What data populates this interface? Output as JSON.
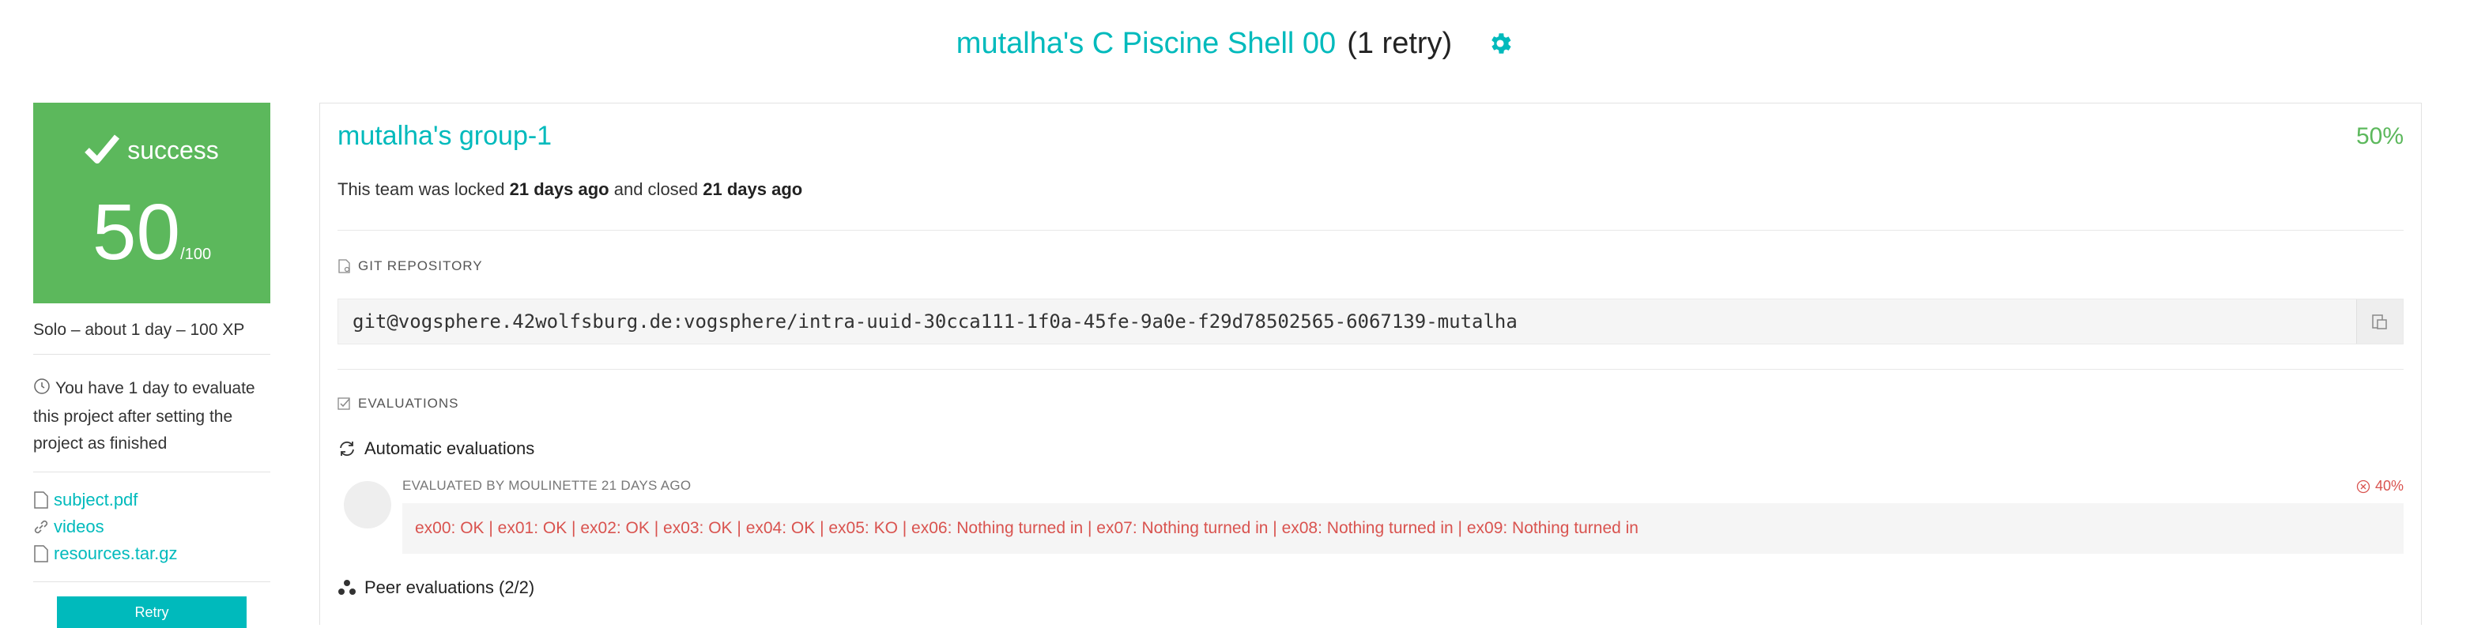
{
  "header": {
    "title": "mutalha's C Piscine Shell 00",
    "retry": "(1 retry)",
    "settings_icon": "gear-icon",
    "accent": "#00babc"
  },
  "status": {
    "label": "success",
    "score": "50",
    "max": "/100",
    "color": "#5cb85c",
    "icon": "check-icon"
  },
  "sidebar": {
    "meta": "Solo – about 1 day – 100 XP",
    "deadline": "You have 1 day to evaluate this project after setting the project as finished",
    "files": [
      {
        "label": "subject.pdf",
        "icon": "file-icon"
      },
      {
        "label": "videos",
        "icon": "link-icon"
      },
      {
        "label": "resources.tar.gz",
        "icon": "file-icon"
      }
    ],
    "retry_label": "Retry"
  },
  "team": {
    "name": "mutalha's group-1",
    "percent": "50%",
    "locked_prefix": "This team was locked",
    "locked_time": "21 days ago",
    "closed_word": "and closed",
    "closed_time": "21 days ago"
  },
  "repo": {
    "section": "GIT REPOSITORY",
    "url": "git@vogsphere.42wolfsburg.de:vogsphere/intra-uuid-30cca111-1f0a-45fe-9a0e-f29d78502565-6067139-mutalha"
  },
  "evaluations": {
    "section": "EVALUATIONS",
    "automatic": "Automatic evaluations",
    "evaluated_by": "EVALUATED BY MOULINETTE 21 DAYS AGO",
    "auto_score": "40%",
    "trace": "ex00: OK | ex01: OK | ex02: OK | ex03: OK | ex04: OK | ex05: KO | ex06: Nothing turned in | ex07: Nothing turned in | ex08: Nothing turned in | ex09: Nothing turned in",
    "peer": "Peer evaluations (2/2)",
    "fail_color": "#d9534f"
  }
}
